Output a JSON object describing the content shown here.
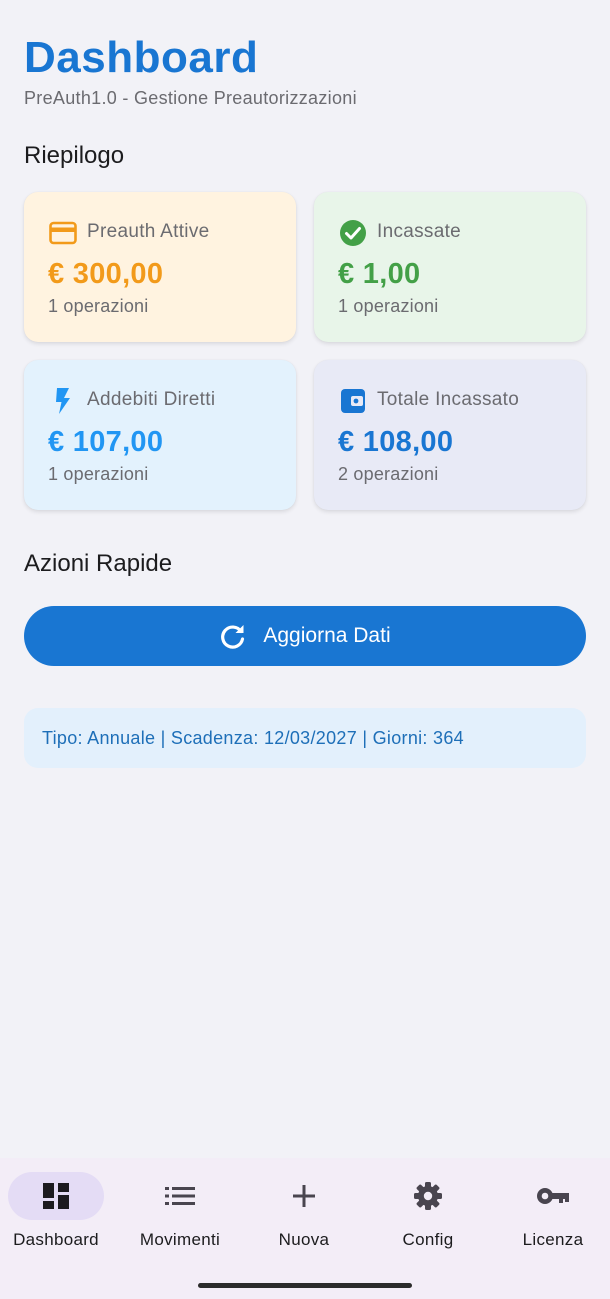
{
  "header": {
    "title": "Dashboard",
    "subtitle": "PreAuth1.0 - Gestione Preautorizzazioni"
  },
  "summary": {
    "title": "Riepilogo",
    "cards": [
      {
        "label": "Preauth Attive",
        "amount": "€ 300,00",
        "count": "1 operazioni",
        "icon": "credit-card-icon",
        "accent": "#f29a1a",
        "background": "#fff3e0"
      },
      {
        "label": "Incassate",
        "amount": "€ 1,00",
        "count": "1 operazioni",
        "icon": "check-circle-icon",
        "accent": "#43a047",
        "background": "#e8f5e9"
      },
      {
        "label": "Addebiti Diretti",
        "amount": "€ 107,00",
        "count": "1 operazioni",
        "icon": "flash-icon",
        "accent": "#2196f3",
        "background": "#e3f2fd"
      },
      {
        "label": "Totale Incassato",
        "amount": "€ 108,00",
        "count": "2 operazioni",
        "icon": "wallet-icon",
        "accent": "#1976d2",
        "background": "#e8eaf6"
      }
    ]
  },
  "actions": {
    "title": "Azioni Rapide",
    "refresh_label": "Aggiorna Dati"
  },
  "license_info": "Tipo: Annuale | Scadenza: 12/03/2027 | Giorni: 364",
  "nav": {
    "items": [
      {
        "label": "Dashboard",
        "icon": "dashboard-icon",
        "active": true
      },
      {
        "label": "Movimenti",
        "icon": "list-icon",
        "active": false
      },
      {
        "label": "Nuova",
        "icon": "plus-icon",
        "active": false
      },
      {
        "label": "Config",
        "icon": "gear-icon",
        "active": false
      },
      {
        "label": "Licenza",
        "icon": "key-icon",
        "active": false
      }
    ]
  },
  "colors": {
    "primary": "#1976d2",
    "nav_background": "#f3edf7",
    "nav_active_pill": "#e4dcf5"
  }
}
